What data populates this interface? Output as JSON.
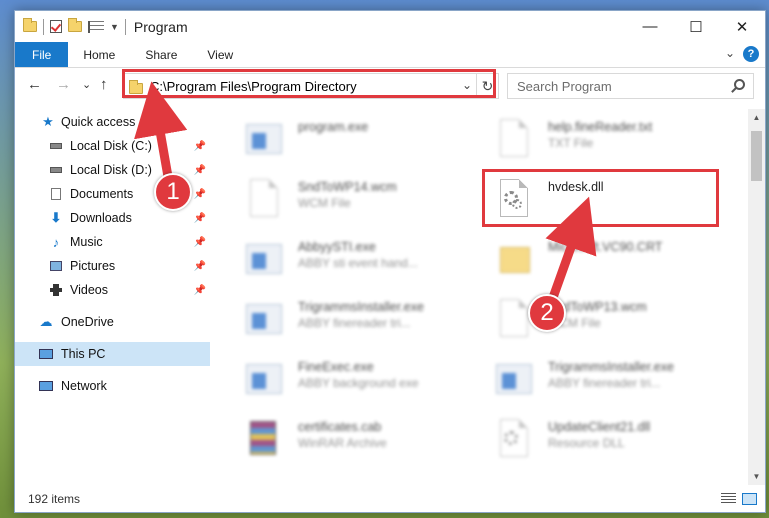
{
  "window": {
    "title": "Program",
    "controls": {
      "minimize": "—",
      "maximize": "☐",
      "close": "✕"
    }
  },
  "ribbon": {
    "tabs": [
      "File",
      "Home",
      "Share",
      "View"
    ],
    "expand": "⌄",
    "help": "?"
  },
  "nav": {
    "back": "←",
    "forward": "→",
    "recent": "⌄",
    "up": "↑",
    "address": "C:\\Program Files\\Program Directory",
    "address_dropdown": "⌄",
    "refresh": "↻",
    "search_placeholder": "Search Program"
  },
  "sidebar": {
    "items": [
      {
        "label": "Quick access",
        "icon": "star-icon",
        "pinned": false
      },
      {
        "label": "Local Disk (C:)",
        "icon": "drive-icon",
        "pinned": true
      },
      {
        "label": "Local Disk (D:)",
        "icon": "drive-icon",
        "pinned": true
      },
      {
        "label": "Documents",
        "icon": "documents-icon",
        "pinned": true
      },
      {
        "label": "Downloads",
        "icon": "download-icon",
        "pinned": true
      },
      {
        "label": "Music",
        "icon": "music-icon",
        "pinned": true
      },
      {
        "label": "Pictures",
        "icon": "pictures-icon",
        "pinned": true
      },
      {
        "label": "Videos",
        "icon": "videos-icon",
        "pinned": true
      },
      {
        "label": "OneDrive",
        "icon": "cloud-icon",
        "pinned": false
      },
      {
        "label": "This PC",
        "icon": "computer-icon",
        "pinned": false,
        "selected": true
      },
      {
        "label": "Network",
        "icon": "network-icon",
        "pinned": false
      }
    ],
    "pin_glyph": "📌"
  },
  "files": [
    {
      "name": "program.exe",
      "type": "",
      "kind": "exe"
    },
    {
      "name": "help.fineReader.txt",
      "type": "TXT File",
      "kind": "doc"
    },
    {
      "name": "SndToWP14.wcm",
      "type": "WCM File",
      "kind": "doc"
    },
    {
      "name": "hvdesk.dll",
      "type": "",
      "kind": "dll"
    },
    {
      "name": "AbbyySTI.exe",
      "type": "ABBY sti event hand...",
      "kind": "exe"
    },
    {
      "name": "Microsoft.VC90.CRT",
      "type": "",
      "kind": "folder"
    },
    {
      "name": "TrigrammsInstaller.exe",
      "type": "ABBY finereader tri...",
      "kind": "exe"
    },
    {
      "name": "SndToWP13.wcm",
      "type": "WCM File",
      "kind": "doc"
    },
    {
      "name": "FineExec.exe",
      "type": "ABBY background exe",
      "kind": "exe"
    },
    {
      "name": "TrigrammsInstaller.exe",
      "type": "ABBY finereader tri...",
      "kind": "exe"
    },
    {
      "name": "certificates.cab",
      "type": "WinRAR Archive",
      "kind": "rar"
    },
    {
      "name": "UpdateClient21.dll",
      "type": "Resource DLL",
      "kind": "dll"
    }
  ],
  "status": {
    "item_count": "192 items"
  },
  "annotations": {
    "step1": "1",
    "step2": "2",
    "highlight_color": "#e0393e"
  }
}
